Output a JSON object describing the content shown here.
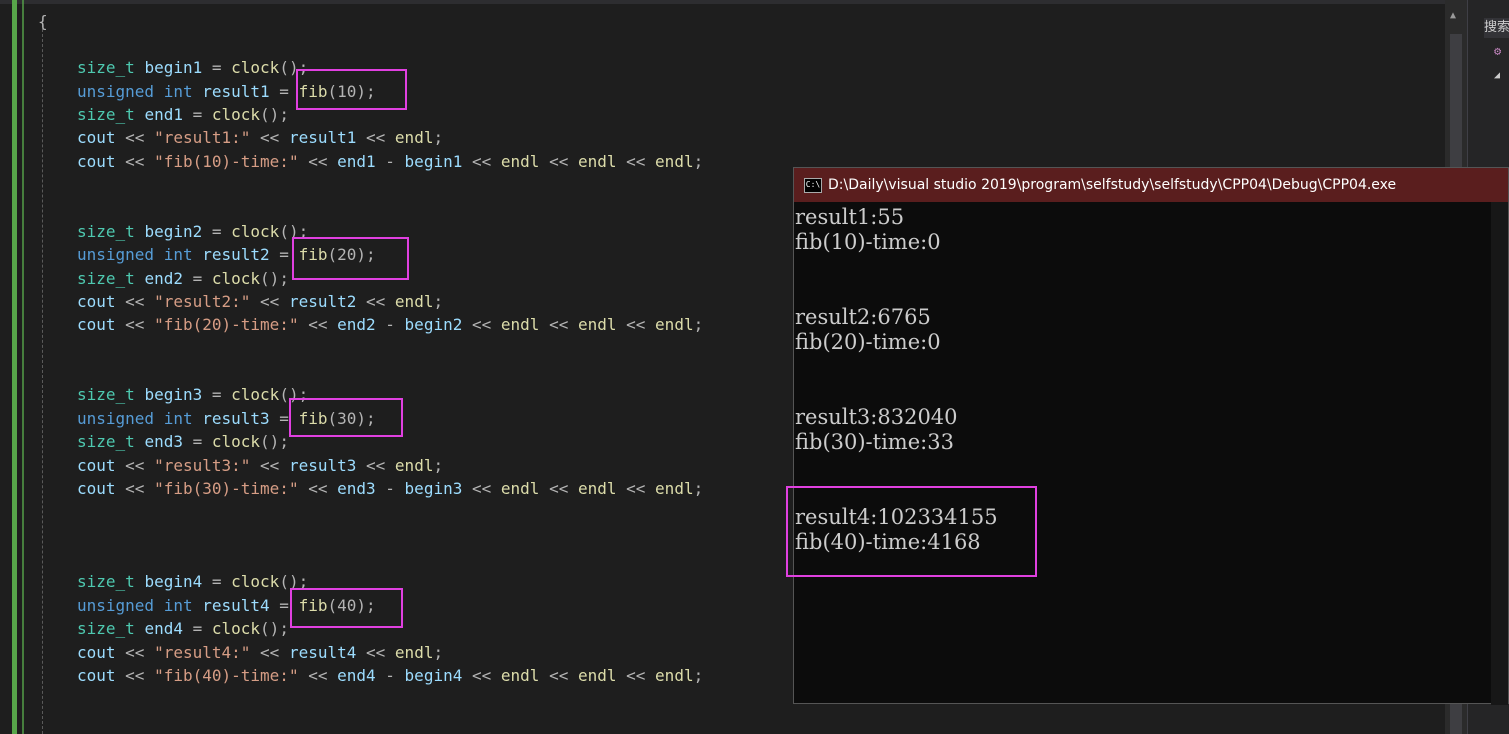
{
  "editor": {
    "lines": [
      {
        "id": "brace",
        "segs": [
          {
            "t": "{",
            "c": "op"
          }
        ]
      },
      {
        "id": "b1",
        "segs": [
          {
            "t": "size_t ",
            "c": "ty"
          },
          {
            "t": "begin1 ",
            "c": "var"
          },
          {
            "t": "= ",
            "c": "op"
          },
          {
            "t": "clock",
            "c": "fn"
          },
          {
            "t": "();",
            "c": "op"
          }
        ]
      },
      {
        "id": "r1",
        "segs": [
          {
            "t": "unsigned int ",
            "c": "kw"
          },
          {
            "t": "result1 ",
            "c": "var"
          },
          {
            "t": "= ",
            "c": "op"
          },
          {
            "t": "fib",
            "c": "fn"
          },
          {
            "t": "(10);",
            "c": "op"
          }
        ]
      },
      {
        "id": "e1",
        "segs": [
          {
            "t": "size_t ",
            "c": "ty"
          },
          {
            "t": "end1 ",
            "c": "var"
          },
          {
            "t": "= ",
            "c": "op"
          },
          {
            "t": "clock",
            "c": "fn"
          },
          {
            "t": "();",
            "c": "op"
          }
        ]
      },
      {
        "id": "c1a",
        "segs": [
          {
            "t": "cout ",
            "c": "var"
          },
          {
            "t": "<< ",
            "c": "op"
          },
          {
            "t": "\"result1:\" ",
            "c": "str"
          },
          {
            "t": "<< ",
            "c": "op"
          },
          {
            "t": "result1 ",
            "c": "var"
          },
          {
            "t": "<< ",
            "c": "op"
          },
          {
            "t": "endl",
            "c": "fn"
          },
          {
            "t": ";",
            "c": "op"
          }
        ]
      },
      {
        "id": "c1b",
        "segs": [
          {
            "t": "cout ",
            "c": "var"
          },
          {
            "t": "<< ",
            "c": "op"
          },
          {
            "t": "\"fib(10)-time:\" ",
            "c": "str"
          },
          {
            "t": "<< ",
            "c": "op"
          },
          {
            "t": "end1 ",
            "c": "var"
          },
          {
            "t": "- ",
            "c": "op"
          },
          {
            "t": "begin1 ",
            "c": "var"
          },
          {
            "t": "<< ",
            "c": "op"
          },
          {
            "t": "endl ",
            "c": "fn"
          },
          {
            "t": "<< ",
            "c": "op"
          },
          {
            "t": "endl ",
            "c": "fn"
          },
          {
            "t": "<< ",
            "c": "op"
          },
          {
            "t": "endl",
            "c": "fn"
          },
          {
            "t": ";",
            "c": "op"
          }
        ]
      },
      {
        "id": "b2",
        "segs": [
          {
            "t": "size_t ",
            "c": "ty"
          },
          {
            "t": "begin2 ",
            "c": "var"
          },
          {
            "t": "= ",
            "c": "op"
          },
          {
            "t": "clock",
            "c": "fn"
          },
          {
            "t": "();",
            "c": "op"
          }
        ]
      },
      {
        "id": "r2",
        "segs": [
          {
            "t": "unsigned int ",
            "c": "kw"
          },
          {
            "t": "result2 ",
            "c": "var"
          },
          {
            "t": "= ",
            "c": "op"
          },
          {
            "t": "fib",
            "c": "fn"
          },
          {
            "t": "(20);",
            "c": "op"
          }
        ]
      },
      {
        "id": "e2",
        "segs": [
          {
            "t": "size_t ",
            "c": "ty"
          },
          {
            "t": "end2 ",
            "c": "var"
          },
          {
            "t": "= ",
            "c": "op"
          },
          {
            "t": "clock",
            "c": "fn"
          },
          {
            "t": "();",
            "c": "op"
          }
        ]
      },
      {
        "id": "c2a",
        "segs": [
          {
            "t": "cout ",
            "c": "var"
          },
          {
            "t": "<< ",
            "c": "op"
          },
          {
            "t": "\"result2:\" ",
            "c": "str"
          },
          {
            "t": "<< ",
            "c": "op"
          },
          {
            "t": "result2 ",
            "c": "var"
          },
          {
            "t": "<< ",
            "c": "op"
          },
          {
            "t": "endl",
            "c": "fn"
          },
          {
            "t": ";",
            "c": "op"
          }
        ]
      },
      {
        "id": "c2b",
        "segs": [
          {
            "t": "cout ",
            "c": "var"
          },
          {
            "t": "<< ",
            "c": "op"
          },
          {
            "t": "\"fib(20)-time:\" ",
            "c": "str"
          },
          {
            "t": "<< ",
            "c": "op"
          },
          {
            "t": "end2 ",
            "c": "var"
          },
          {
            "t": "- ",
            "c": "op"
          },
          {
            "t": "begin2 ",
            "c": "var"
          },
          {
            "t": "<< ",
            "c": "op"
          },
          {
            "t": "endl ",
            "c": "fn"
          },
          {
            "t": "<< ",
            "c": "op"
          },
          {
            "t": "endl ",
            "c": "fn"
          },
          {
            "t": "<< ",
            "c": "op"
          },
          {
            "t": "endl",
            "c": "fn"
          },
          {
            "t": ";",
            "c": "op"
          }
        ]
      },
      {
        "id": "b3",
        "segs": [
          {
            "t": "size_t ",
            "c": "ty"
          },
          {
            "t": "begin3 ",
            "c": "var"
          },
          {
            "t": "= ",
            "c": "op"
          },
          {
            "t": "clock",
            "c": "fn"
          },
          {
            "t": "();",
            "c": "op"
          }
        ]
      },
      {
        "id": "r3",
        "segs": [
          {
            "t": "unsigned int ",
            "c": "kw"
          },
          {
            "t": "result3 ",
            "c": "var"
          },
          {
            "t": "= ",
            "c": "op"
          },
          {
            "t": "fib",
            "c": "fn"
          },
          {
            "t": "(30);",
            "c": "op"
          }
        ]
      },
      {
        "id": "e3",
        "segs": [
          {
            "t": "size_t ",
            "c": "ty"
          },
          {
            "t": "end3 ",
            "c": "var"
          },
          {
            "t": "= ",
            "c": "op"
          },
          {
            "t": "clock",
            "c": "fn"
          },
          {
            "t": "();",
            "c": "op"
          }
        ]
      },
      {
        "id": "c3a",
        "segs": [
          {
            "t": "cout ",
            "c": "var"
          },
          {
            "t": "<< ",
            "c": "op"
          },
          {
            "t": "\"result3:\" ",
            "c": "str"
          },
          {
            "t": "<< ",
            "c": "op"
          },
          {
            "t": "result3 ",
            "c": "var"
          },
          {
            "t": "<< ",
            "c": "op"
          },
          {
            "t": "endl",
            "c": "fn"
          },
          {
            "t": ";",
            "c": "op"
          }
        ]
      },
      {
        "id": "c3b",
        "segs": [
          {
            "t": "cout ",
            "c": "var"
          },
          {
            "t": "<< ",
            "c": "op"
          },
          {
            "t": "\"fib(30)-time:\" ",
            "c": "str"
          },
          {
            "t": "<< ",
            "c": "op"
          },
          {
            "t": "end3 ",
            "c": "var"
          },
          {
            "t": "- ",
            "c": "op"
          },
          {
            "t": "begin3 ",
            "c": "var"
          },
          {
            "t": "<< ",
            "c": "op"
          },
          {
            "t": "endl ",
            "c": "fn"
          },
          {
            "t": "<< ",
            "c": "op"
          },
          {
            "t": "endl ",
            "c": "fn"
          },
          {
            "t": "<< ",
            "c": "op"
          },
          {
            "t": "endl",
            "c": "fn"
          },
          {
            "t": ";",
            "c": "op"
          }
        ]
      },
      {
        "id": "b4",
        "segs": [
          {
            "t": "size_t ",
            "c": "ty"
          },
          {
            "t": "begin4 ",
            "c": "var"
          },
          {
            "t": "= ",
            "c": "op"
          },
          {
            "t": "clock",
            "c": "fn"
          },
          {
            "t": "();",
            "c": "op"
          }
        ]
      },
      {
        "id": "r4",
        "segs": [
          {
            "t": "unsigned int ",
            "c": "kw"
          },
          {
            "t": "result4 ",
            "c": "var"
          },
          {
            "t": "= ",
            "c": "op"
          },
          {
            "t": "fib",
            "c": "fn"
          },
          {
            "t": "(40);",
            "c": "op"
          }
        ]
      },
      {
        "id": "e4",
        "segs": [
          {
            "t": "size_t ",
            "c": "ty"
          },
          {
            "t": "end4 ",
            "c": "var"
          },
          {
            "t": "= ",
            "c": "op"
          },
          {
            "t": "clock",
            "c": "fn"
          },
          {
            "t": "();",
            "c": "op"
          }
        ]
      },
      {
        "id": "c4a",
        "segs": [
          {
            "t": "cout ",
            "c": "var"
          },
          {
            "t": "<< ",
            "c": "op"
          },
          {
            "t": "\"result4:\" ",
            "c": "str"
          },
          {
            "t": "<< ",
            "c": "op"
          },
          {
            "t": "result4 ",
            "c": "var"
          },
          {
            "t": "<< ",
            "c": "op"
          },
          {
            "t": "endl",
            "c": "fn"
          },
          {
            "t": ";",
            "c": "op"
          }
        ]
      },
      {
        "id": "c4b",
        "segs": [
          {
            "t": "cout ",
            "c": "var"
          },
          {
            "t": "<< ",
            "c": "op"
          },
          {
            "t": "\"fib(40)-time:\" ",
            "c": "str"
          },
          {
            "t": "<< ",
            "c": "op"
          },
          {
            "t": "end4 ",
            "c": "var"
          },
          {
            "t": "- ",
            "c": "op"
          },
          {
            "t": "begin4 ",
            "c": "var"
          },
          {
            "t": "<< ",
            "c": "op"
          },
          {
            "t": "endl ",
            "c": "fn"
          },
          {
            "t": "<< ",
            "c": "op"
          },
          {
            "t": "endl ",
            "c": "fn"
          },
          {
            "t": "<< ",
            "c": "op"
          },
          {
            "t": "endl",
            "c": "fn"
          },
          {
            "t": ";",
            "c": "op"
          }
        ]
      }
    ]
  },
  "console": {
    "title": "D:\\Daily\\visual studio 2019\\program\\selfstudy\\selfstudy\\CPP04\\Debug\\CPP04.exe",
    "icon_label": "C:\\",
    "output": [
      "result1:55",
      "fib(10)-time:0",
      "result2:6765",
      "fib(20)-time:0",
      "result3:832040",
      "fib(30)-time:33",
      "result4:102334155",
      "fib(40)-time:4168"
    ]
  },
  "right_panel": {
    "search_label": "搜索"
  },
  "icons": {
    "console_icon": "cmd-icon",
    "scroll_up": "scroll-up-arrow-icon",
    "panel_icon": "purple-gear-icon",
    "panel_triangle": "triangle-icon"
  },
  "colors": {
    "highlight": "#e040e0",
    "console_title_bg": "#5a1e1e",
    "editor_bg": "#1e1e1e"
  }
}
